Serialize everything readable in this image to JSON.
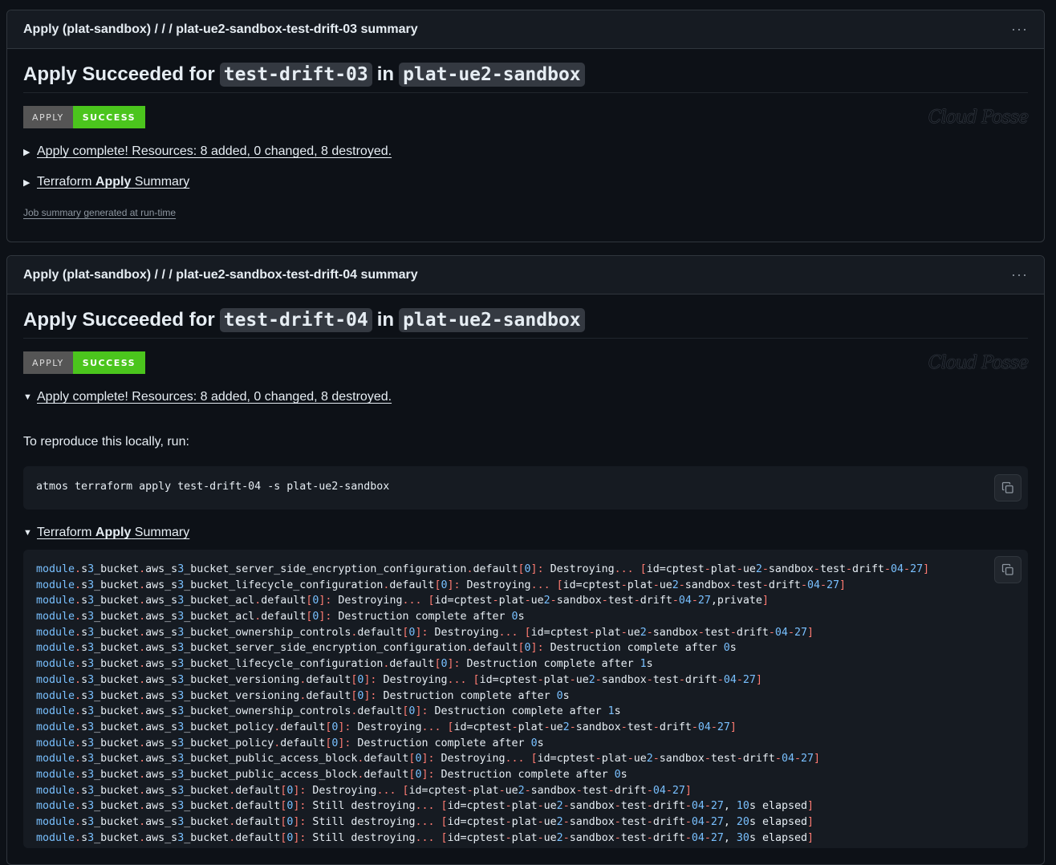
{
  "cards": [
    {
      "header_title": "Apply (plat-sandbox) / / / plat-ue2-sandbox-test-drift-03 summary",
      "heading_prefix": "Apply Succeeded for",
      "component": "test-drift-03",
      "heading_in": "in",
      "stack": "plat-ue2-sandbox",
      "badge_left": "APPLY",
      "badge_right": "SUCCESS",
      "brand": "Cloud Posse",
      "details1": "Apply complete! Resources: 8 added, 0 changed, 8 destroyed.",
      "details2_pre": "Terraform ",
      "details2_bold": "Apply",
      "details2_post": " Summary",
      "footer": "Job summary generated at run-time"
    },
    {
      "header_title": "Apply (plat-sandbox) / / / plat-ue2-sandbox-test-drift-04 summary",
      "heading_prefix": "Apply Succeeded for",
      "component": "test-drift-04",
      "heading_in": "in",
      "stack": "plat-ue2-sandbox",
      "badge_left": "APPLY",
      "badge_right": "SUCCESS",
      "brand": "Cloud Posse",
      "details1": "Apply complete! Resources: 8 added, 0 changed, 8 destroyed.",
      "reproduce_text": "To reproduce this locally, run:",
      "command": "atmos terraform apply test-drift-04 -s plat-ue2-sandbox",
      "details2_pre": "Terraform ",
      "details2_bold": "Apply",
      "details2_post": " Summary",
      "log_lines": [
        "module.s3_bucket.aws_s3_bucket_server_side_encryption_configuration.default[0]: Destroying... [id=cptest-plat-ue2-sandbox-test-drift-04-27]",
        "module.s3_bucket.aws_s3_bucket_lifecycle_configuration.default[0]: Destroying... [id=cptest-plat-ue2-sandbox-test-drift-04-27]",
        "module.s3_bucket.aws_s3_bucket_acl.default[0]: Destroying... [id=cptest-plat-ue2-sandbox-test-drift-04-27,private]",
        "module.s3_bucket.aws_s3_bucket_acl.default[0]: Destruction complete after 0s",
        "module.s3_bucket.aws_s3_bucket_ownership_controls.default[0]: Destroying... [id=cptest-plat-ue2-sandbox-test-drift-04-27]",
        "module.s3_bucket.aws_s3_bucket_server_side_encryption_configuration.default[0]: Destruction complete after 0s",
        "module.s3_bucket.aws_s3_bucket_lifecycle_configuration.default[0]: Destruction complete after 1s",
        "module.s3_bucket.aws_s3_bucket_versioning.default[0]: Destroying... [id=cptest-plat-ue2-sandbox-test-drift-04-27]",
        "module.s3_bucket.aws_s3_bucket_versioning.default[0]: Destruction complete after 0s",
        "module.s3_bucket.aws_s3_bucket_ownership_controls.default[0]: Destruction complete after 1s",
        "module.s3_bucket.aws_s3_bucket_policy.default[0]: Destroying... [id=cptest-plat-ue2-sandbox-test-drift-04-27]",
        "module.s3_bucket.aws_s3_bucket_policy.default[0]: Destruction complete after 0s",
        "module.s3_bucket.aws_s3_bucket_public_access_block.default[0]: Destroying... [id=cptest-plat-ue2-sandbox-test-drift-04-27]",
        "module.s3_bucket.aws_s3_bucket_public_access_block.default[0]: Destruction complete after 0s",
        "module.s3_bucket.aws_s3_bucket.default[0]: Destroying... [id=cptest-plat-ue2-sandbox-test-drift-04-27]",
        "module.s3_bucket.aws_s3_bucket.default[0]: Still destroying... [id=cptest-plat-ue2-sandbox-test-drift-04-27, 10s elapsed]",
        "module.s3_bucket.aws_s3_bucket.default[0]: Still destroying... [id=cptest-plat-ue2-sandbox-test-drift-04-27, 20s elapsed]",
        "module.s3_bucket.aws_s3_bucket.default[0]: Still destroying... [id=cptest-plat-ue2-sandbox-test-drift-04-27, 30s elapsed]"
      ]
    }
  ],
  "colors": {
    "background": "#0d1117",
    "badge_success": "#4bc51d",
    "badge_label": "#555555",
    "syntax_keyword": "#79c0ff",
    "syntax_punct": "#ff7b72"
  }
}
